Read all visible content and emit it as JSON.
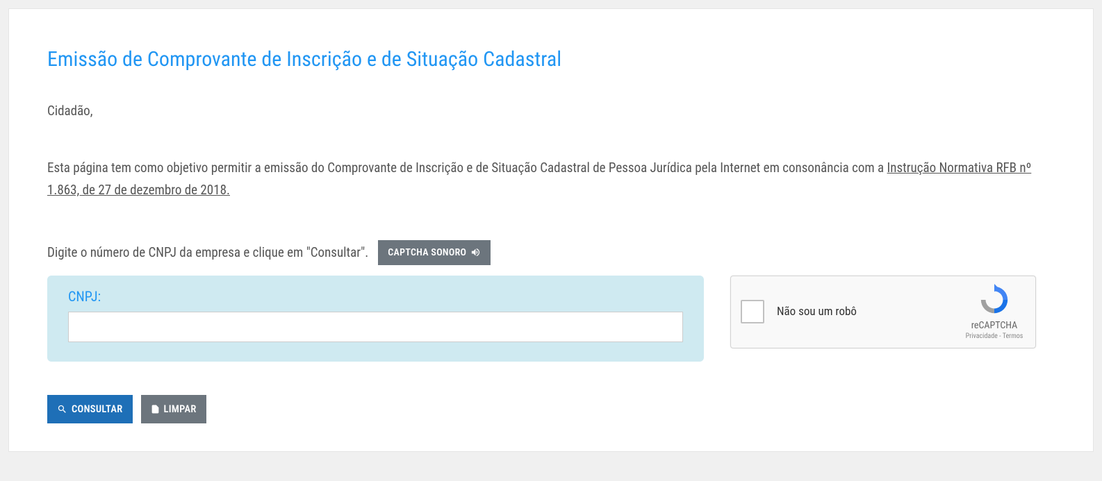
{
  "title": "Emissão de Comprovante de Inscrição e de Situação Cadastral",
  "greeting": "Cidadão,",
  "intro_prefix": "Esta página tem como objetivo permitir a emissão do Comprovante de Inscrição e de Situação Cadastral de Pessoa Jurídica pela Internet em consonância com a ",
  "intro_link": "Instrução Normativa RFB nº 1.863, de 27 de dezembro de 2018.",
  "instruction": "Digite o número de CNPJ da empresa e clique em \"Consultar\".",
  "captcha_audio_label": "CAPTCHA SONORO",
  "cnpj": {
    "label": "CNPJ:",
    "value": ""
  },
  "recaptcha": {
    "label": "Não sou um robô",
    "brand": "reCAPTCHA",
    "privacy": "Privacidade",
    "terms": "Termos"
  },
  "buttons": {
    "consultar": "CONSULTAR",
    "limpar": "LIMPAR"
  }
}
